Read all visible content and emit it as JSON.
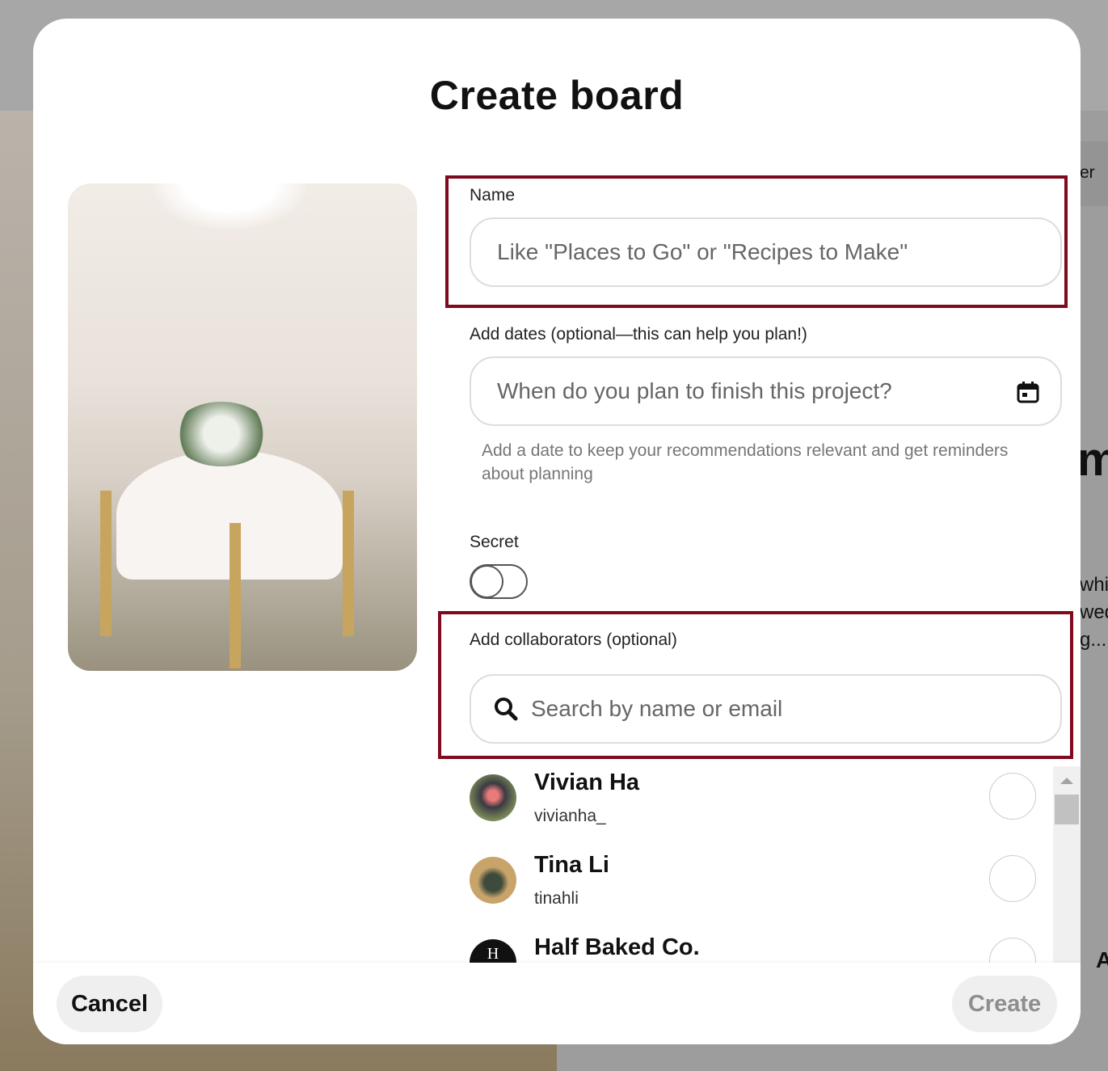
{
  "background": {
    "fragments": [
      "er",
      "m",
      "whit",
      "wed",
      "g...",
      "A"
    ]
  },
  "modal": {
    "title": "Create board",
    "name": {
      "label": "Name",
      "placeholder": "Like \"Places to Go\" or \"Recipes to Make\""
    },
    "dates": {
      "label": "Add dates (optional—this can help you plan!)",
      "placeholder": "When do you plan to finish this project?",
      "hint": "Add a date to keep your recommendations relevant and get reminders about planning",
      "icon": "calendar-icon"
    },
    "secret": {
      "label": "Secret",
      "enabled": false
    },
    "collaborators": {
      "label": "Add collaborators (optional)",
      "placeholder": "Search by name or email",
      "icon": "search-icon",
      "people": [
        {
          "name": "Vivian Ha",
          "handle": "vivianha_"
        },
        {
          "name": "Tina Li",
          "handle": "tinahli"
        },
        {
          "name": "Half Baked Co.",
          "handle": ""
        }
      ]
    },
    "footer": {
      "cancel": "Cancel",
      "create": "Create"
    }
  },
  "colors": {
    "highlight": "#7f0a1e"
  }
}
